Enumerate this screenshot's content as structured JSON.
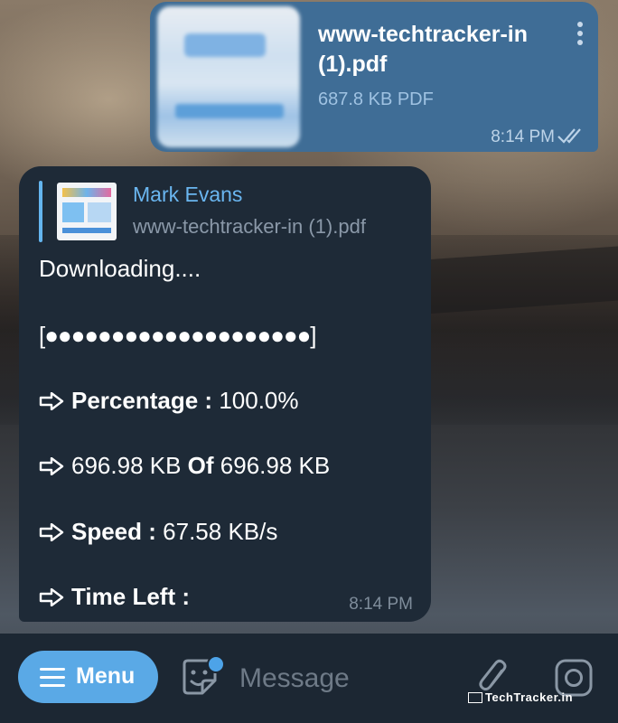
{
  "file_message": {
    "file_name_line1": "www-techtracker-in",
    "file_name_line2": "(1).pdf",
    "file_size": "687.8 KB PDF",
    "time": "8:14 PM",
    "status": "read-double-check-icon"
  },
  "bot_message": {
    "reply": {
      "sender": "Mark Evans",
      "file_name": "www-techtracker-in (1).pdf"
    },
    "status_line": "Downloading....",
    "progress_bar": "[●●●●●●●●●●●●●●●●●●●●]",
    "progress_fraction": 1.0,
    "percentage_label": "Percentage :",
    "percentage_value": "100.0%",
    "downloaded": "696.98 KB",
    "of_label": "Of",
    "total": "696.98 KB",
    "speed_label": "Speed :",
    "speed_value": "67.58 KB/s",
    "time_left_label": "Time Left :",
    "time": "8:14 PM"
  },
  "input_bar": {
    "menu_label": "Menu",
    "placeholder": "Message",
    "icons": [
      "menu-icon",
      "sticker-icon",
      "attach-paperclip-icon",
      "camera-icon"
    ]
  },
  "watermark": "TechTracker.in",
  "colors": {
    "outgoing_bubble": "#3f6d96",
    "incoming_bubble": "#1e2a37",
    "accent": "#5aa9e6",
    "sender_name": "#6ab6f0"
  }
}
